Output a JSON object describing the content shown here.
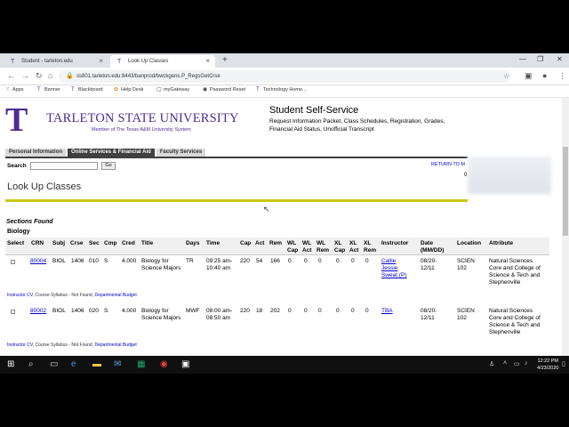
{
  "browser": {
    "tabs": [
      {
        "title": "Student - tarleton.edu"
      },
      {
        "title": "Look Up Classes"
      }
    ],
    "url": "ss801.tarleton.edu:8443/banprod/bwckgens.P_RegsGetCrse",
    "bookmarks": [
      {
        "label": "Apps"
      },
      {
        "label": "Banner"
      },
      {
        "label": "Blackboard"
      },
      {
        "label": "Help Desk"
      },
      {
        "label": "myGateway"
      },
      {
        "label": "Password Reset"
      },
      {
        "label": "Technology Home..."
      }
    ]
  },
  "header": {
    "logo_letter": "T",
    "university": "TARLETON STATE UNIVERSITY",
    "member_line": "Member of The Texas A&M University System",
    "title": "Student Self-Service",
    "subtitle": "Request Information Packet, Class Schedules, Registration, Grades, Financial Aid Status, Unofficial Transcript"
  },
  "nav": {
    "tabs": [
      {
        "label": "Personal Information",
        "active": false
      },
      {
        "label": "Online Services & Financial Aid",
        "active": true
      },
      {
        "label": "Faculty Services",
        "active": false
      }
    ]
  },
  "search": {
    "label": "Search",
    "value": "",
    "go": "Go",
    "return_link": "RETURN TO M",
    "count": "0"
  },
  "page": {
    "title": "Look Up Classes",
    "sections_found": "Sections Found",
    "subject": "Biology"
  },
  "table": {
    "headers": {
      "select": "Select",
      "crn": "CRN",
      "subj": "Subj",
      "crse": "Crse",
      "sec": "Sec",
      "cmp": "Cmp",
      "cred": "Cred",
      "title": "Title",
      "days": "Days",
      "time": "Time",
      "cap": "Cap",
      "act": "Act",
      "rem": "Rem",
      "wl_cap": "WL Cap",
      "wl_act": "WL Act",
      "wl_rem": "WL Rem",
      "xl_cap": "XL Cap",
      "xl_act": "XL Act",
      "xl_rem": "XL Rem",
      "instructor": "Instructor",
      "date": "Date (MM/DD)",
      "location": "Location",
      "attribute": "Attribute"
    },
    "rows": [
      {
        "crn": "80004",
        "subj": "BIOL",
        "crse": "1406",
        "sec": "010",
        "cmp": "S",
        "cred": "4.000",
        "title": "Biology for Science Majors",
        "days": "TR",
        "time": "09:25 am-10:40 am",
        "cap": "220",
        "act": "54",
        "rem": "166",
        "wl_cap": "0",
        "wl_act": "0",
        "wl_rem": "0",
        "xl_cap": "0",
        "xl_act": "0",
        "xl_rem": "0",
        "instructor": "Callie Jessie Sweat (P)",
        "date": "08/20-12/11",
        "location": "SCIEN 102",
        "attribute": "Natural Sciences Core and College of Science & Tech and Stephenville",
        "links_prefix": "Instructor CV",
        "links_mid": ", Course Syllabus - Not Found, ",
        "links_budget": "Departmental Budget"
      },
      {
        "crn": "80002",
        "subj": "BIOL",
        "crse": "1406",
        "sec": "020",
        "cmp": "S",
        "cred": "4.000",
        "title": "Biology for Science Majors",
        "days": "MWF",
        "time": "08:00 am-08:50 am",
        "cap": "220",
        "act": "18",
        "rem": "202",
        "wl_cap": "0",
        "wl_act": "0",
        "wl_rem": "0",
        "xl_cap": "0",
        "xl_act": "0",
        "xl_rem": "0",
        "instructor": "TBA",
        "date": "08/20-12/11",
        "location": "SCIEN 102",
        "attribute": "Natural Sciences Core and College of Science & Tech and Stephenville",
        "links_prefix": "Instructor CV",
        "links_mid": ", Course Syllabus - Not Found, ",
        "links_budget": "Departmental Budget"
      }
    ]
  },
  "taskbar": {
    "time": "12:22 PM",
    "date": "4/23/2020"
  },
  "colors": {
    "brand_purple": "#4c2c92",
    "link_blue": "#0000cc",
    "nav_dark": "#3f3f3f",
    "rule_yellow": "#c8c814"
  }
}
